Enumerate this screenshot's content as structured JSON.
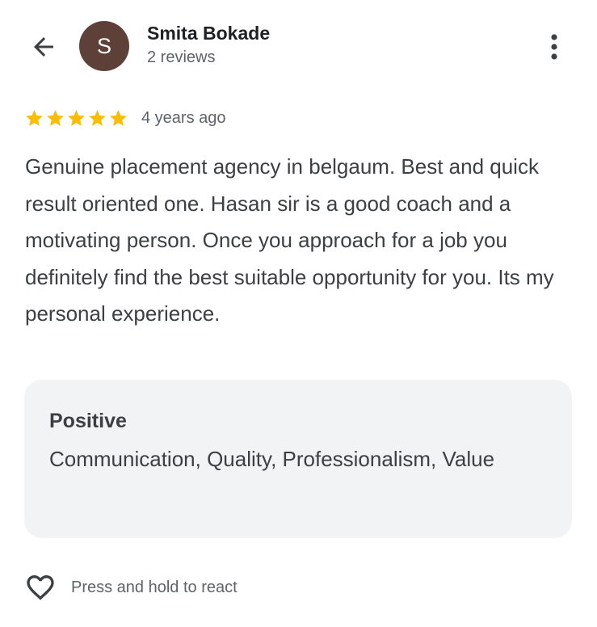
{
  "header": {
    "back_icon": "arrow-left-icon",
    "author": {
      "initial": "S",
      "avatar_color": "#5d4037",
      "name": "Smita Bokade",
      "meta": "2 reviews"
    },
    "more_icon": "more-vertical-icon"
  },
  "review": {
    "rating": 5,
    "max_rating": 5,
    "star_color": "#fbbc04",
    "star_icon": "star-icon",
    "date": "4 years ago",
    "text": "Genuine placement agency in belgaum. Best and quick result oriented one. Hasan sir is a good coach and a motivating person. Once you approach for a job you definitely find the best suitable opportunity for you. Its my personal experience."
  },
  "attributes": {
    "title": "Positive",
    "values": "Communication, Quality, Professionalism, Value"
  },
  "react": {
    "icon": "heart-outline-icon",
    "label": "Press and hold to react"
  }
}
